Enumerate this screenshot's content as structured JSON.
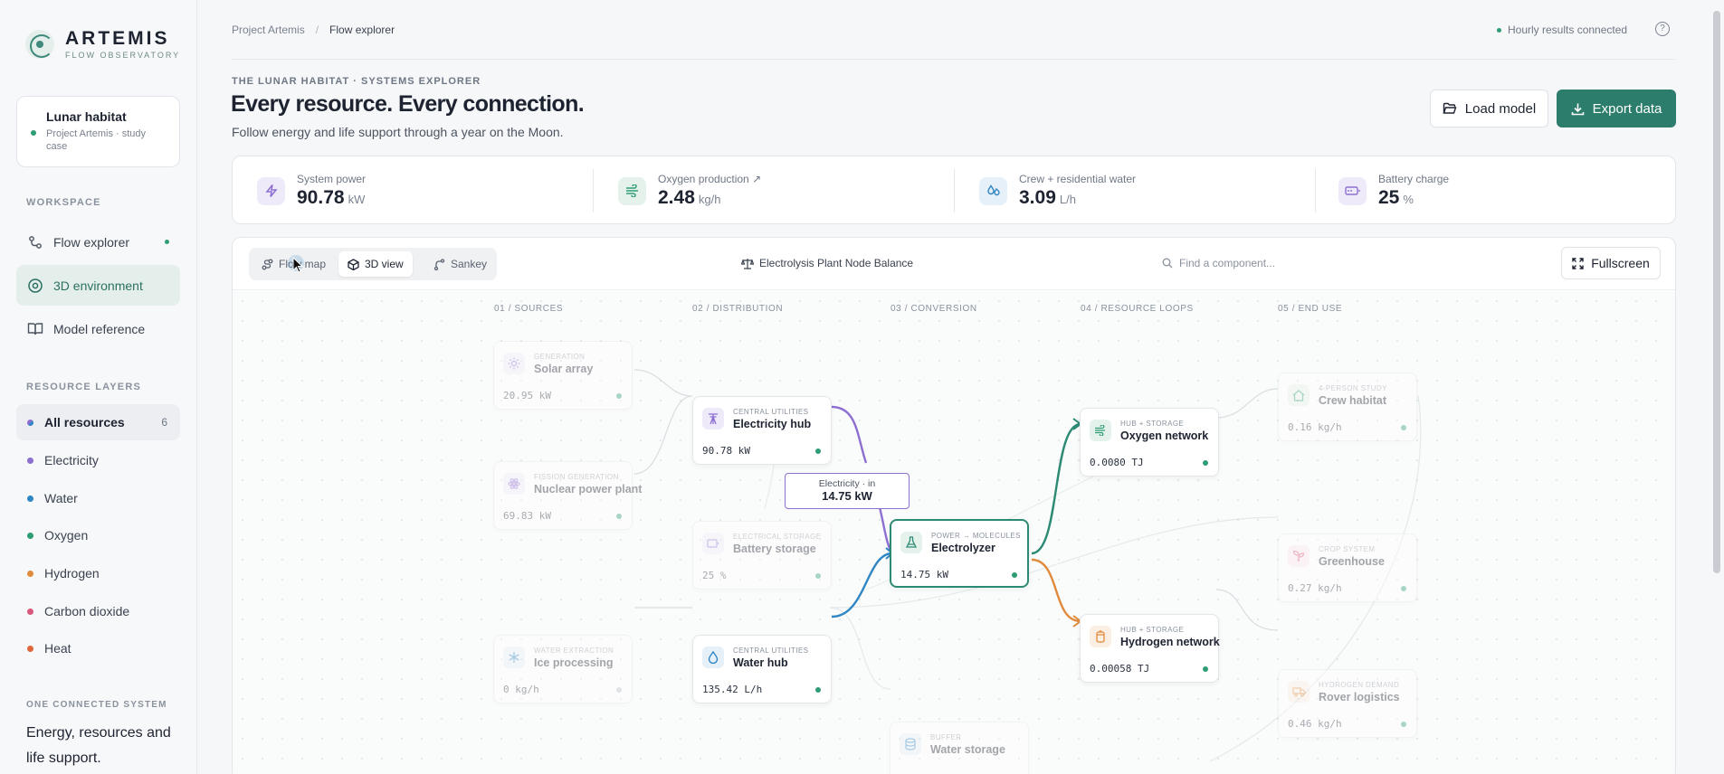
{
  "brand": {
    "name": "ARTEMIS",
    "sub": "FLOW OBSERVATORY"
  },
  "project": {
    "title": "Lunar habitat",
    "subtitle": "Project Artemis · study case"
  },
  "workspace": {
    "label": "WORKSPACE",
    "items": [
      {
        "label": "Flow explorer",
        "icon": "flow-icon",
        "indicator": true
      },
      {
        "label": "3D environment",
        "icon": "orbit-icon",
        "active": true
      },
      {
        "label": "Model reference",
        "icon": "book-icon"
      }
    ]
  },
  "layers": {
    "label": "RESOURCE LAYERS",
    "all": {
      "label": "All resources",
      "count": "6"
    },
    "items": [
      {
        "label": "Electricity",
        "color": "#8d6fd1"
      },
      {
        "label": "Water",
        "color": "#2f86c4"
      },
      {
        "label": "Oxygen",
        "color": "#2e9d74"
      },
      {
        "label": "Hydrogen",
        "color": "#e08a3c"
      },
      {
        "label": "Carbon dioxide",
        "color": "#d8577a"
      },
      {
        "label": "Heat",
        "color": "#e0663c"
      }
    ]
  },
  "footer": {
    "label": "ONE CONNECTED SYSTEM",
    "tagline": "Energy, resources and life support."
  },
  "breadcrumb": {
    "root": "Project Artemis",
    "sep": "/",
    "current": "Flow explorer"
  },
  "status": {
    "text": "Hourly results connected",
    "help": "?"
  },
  "header": {
    "eyebrow": "THE LUNAR HABITAT · SYSTEMS EXPLORER",
    "title": "Every resource. Every connection.",
    "subtitle": "Follow energy and life support through a year on the Moon.",
    "load_label": "Load model",
    "export_label": "Export data"
  },
  "stats": [
    {
      "label": "System power",
      "value": "90.78",
      "unit": "kW",
      "icon": "bolt-icon",
      "color": "#8d6fd1"
    },
    {
      "label": "Oxygen production ↗",
      "value": "2.48",
      "unit": "kg/h",
      "icon": "wind-icon",
      "color": "#2e9d74"
    },
    {
      "label": "Crew + residential water",
      "value": "3.09",
      "unit": "L/h",
      "icon": "droplets-icon",
      "color": "#2f86c4"
    },
    {
      "label": "Battery charge",
      "value": "25",
      "unit": "%",
      "icon": "battery-icon",
      "color": "#8d6fd1"
    }
  ],
  "toolbar": {
    "views": [
      "Flow map",
      "3D view",
      "Sankey"
    ],
    "active_view": "3D view",
    "node_balance": "Electrolysis Plant Node Balance",
    "search_placeholder": "Find a component...",
    "fullscreen": "Fullscreen"
  },
  "columns": [
    "01 / SOURCES",
    "02 / DISTRIBUTION",
    "03 / CONVERSION",
    "04 / RESOURCE LOOPS",
    "05 / END USE"
  ],
  "nodes": {
    "solar": {
      "kicker": "GENERATION",
      "name": "Solar array",
      "value": "20.95 kW",
      "icon": "sun-icon"
    },
    "nuclear": {
      "kicker": "FISSION GENERATION",
      "name": "Nuclear power plant",
      "value": "69.83 kW",
      "icon": "atom-icon"
    },
    "ice": {
      "kicker": "WATER EXTRACTION",
      "name": "Ice processing",
      "value": "0 kg/h",
      "icon": "snowflake-icon"
    },
    "elec_hub": {
      "kicker": "CENTRAL UTILITIES",
      "name": "Electricity hub",
      "value": "90.78 kW",
      "icon": "pylon-icon"
    },
    "battery": {
      "kicker": "ELECTRICAL STORAGE",
      "name": "Battery storage",
      "value": "25 %",
      "icon": "battery-icon"
    },
    "water_hub": {
      "kicker": "CENTRAL UTILITIES",
      "name": "Water hub",
      "value": "135.42 L/h",
      "icon": "droplet-icon"
    },
    "electrolyzer": {
      "kicker": "POWER → MOLECULES",
      "name": "Electrolyzer",
      "value": "14.75 kW",
      "icon": "flask-icon"
    },
    "water_storage": {
      "kicker": "BUFFER",
      "name": "Water storage",
      "value": "",
      "icon": "database-icon"
    },
    "oxygen_net": {
      "kicker": "HUB + STORAGE",
      "name": "Oxygen network",
      "value": "0.0080 TJ",
      "icon": "wind-icon"
    },
    "hydrogen_net": {
      "kicker": "HUB + STORAGE",
      "name": "Hydrogen network",
      "value": "0.00058 TJ",
      "icon": "cylinder-icon"
    },
    "crew": {
      "kicker": "4-PERSON STUDY",
      "name": "Crew habitat",
      "value": "0.16 kg/h",
      "icon": "home-icon"
    },
    "greenhouse": {
      "kicker": "CROP SYSTEM",
      "name": "Greenhouse",
      "value": "0.27 kg/h",
      "icon": "sprout-icon"
    },
    "rover": {
      "kicker": "HYDROGEN DEMAND",
      "name": "Rover logistics",
      "value": "0.46 kg/h",
      "icon": "truck-icon"
    }
  },
  "edge_label": {
    "title": "Electricity · in",
    "value": "14.75 kW"
  }
}
